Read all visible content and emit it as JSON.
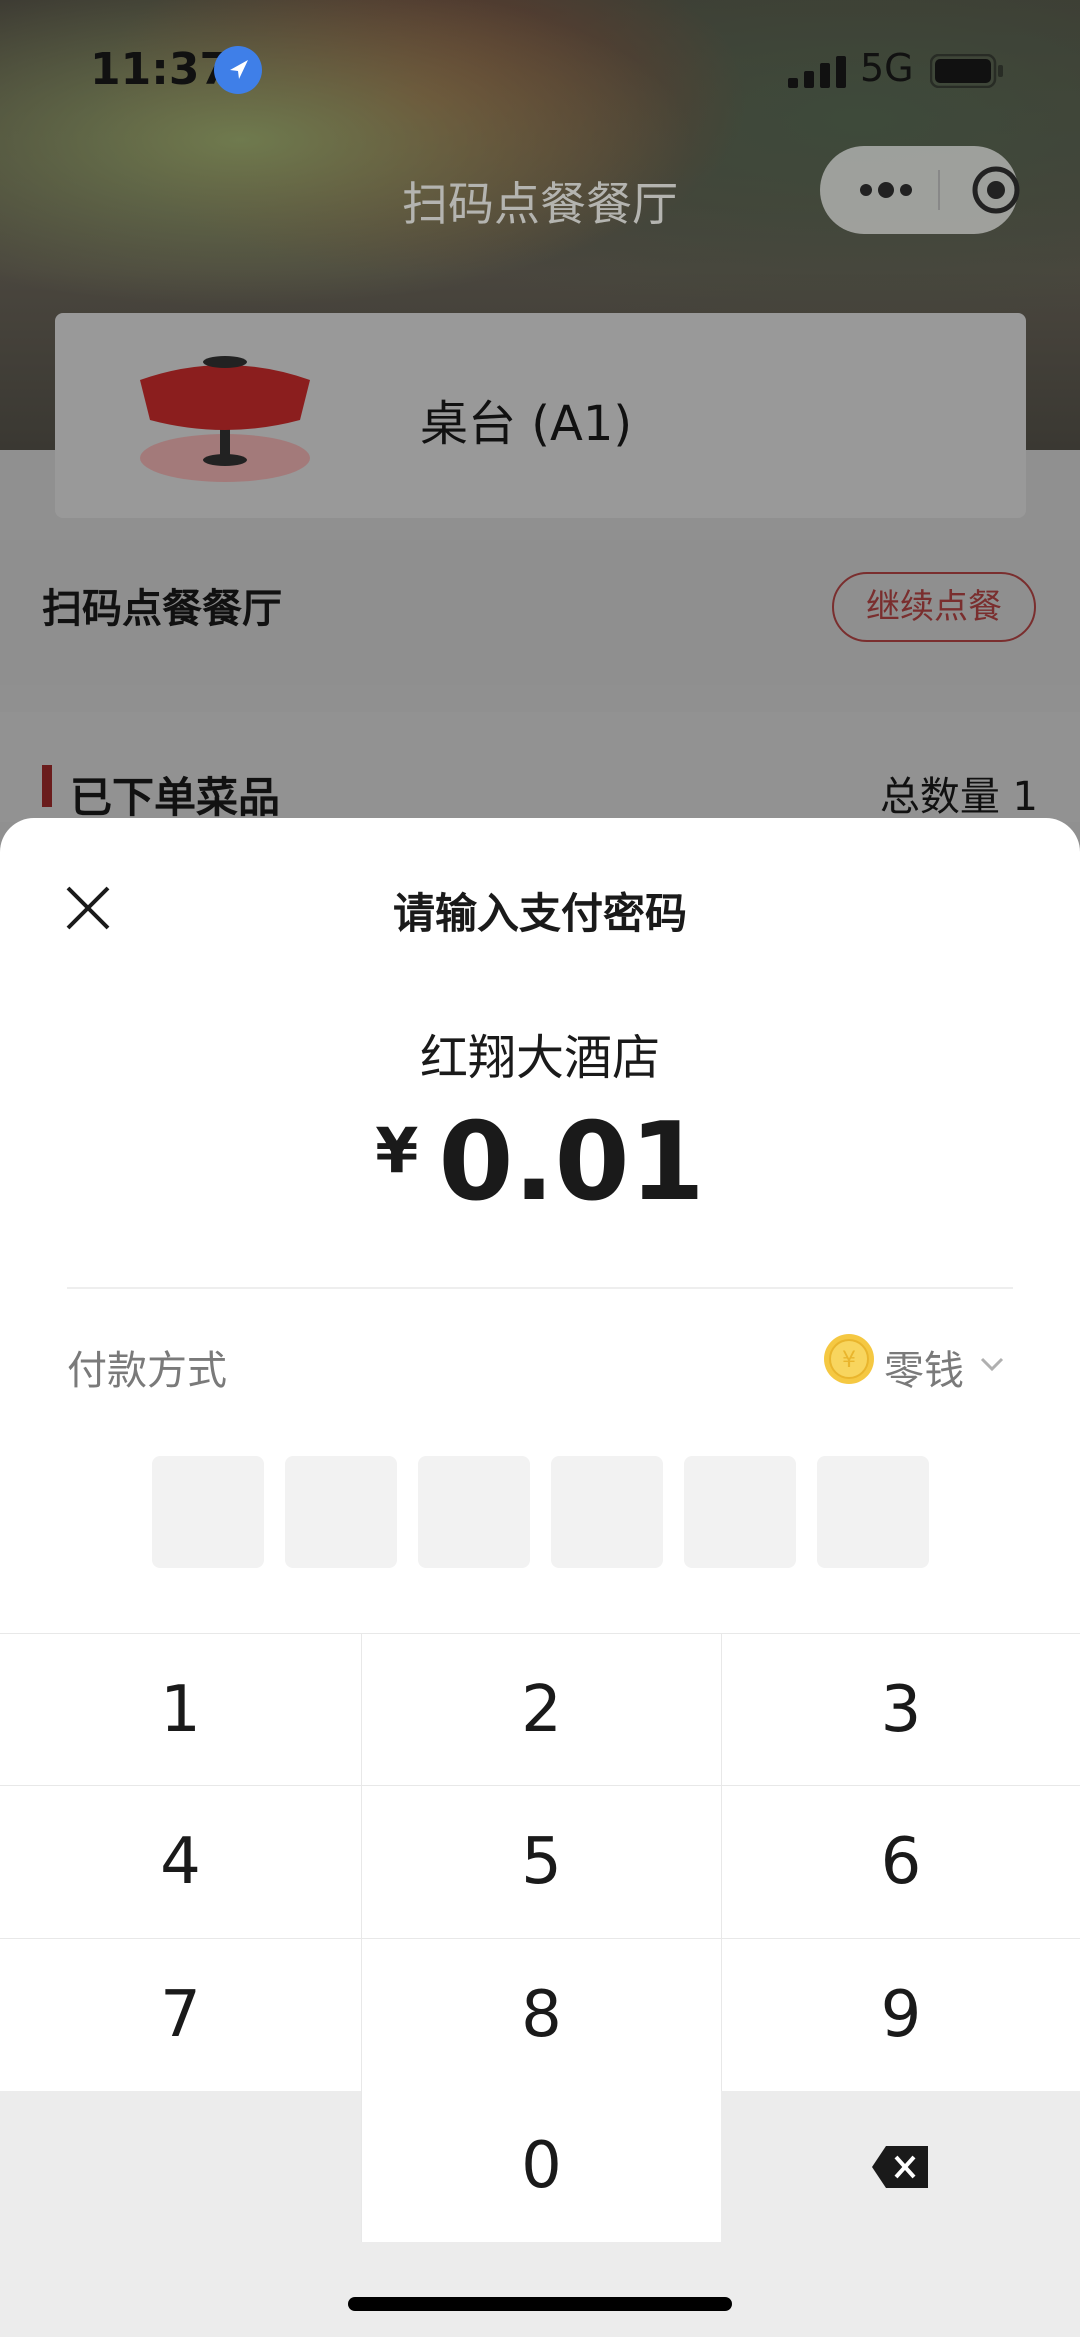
{
  "status_bar": {
    "time": "11:37",
    "network": "5G",
    "location_icon": "location-arrow-icon",
    "signal_icon": "cellular-signal-icon",
    "battery_icon": "battery-icon"
  },
  "header": {
    "title": "扫码点餐餐厅",
    "more_icon": "more-dots-icon",
    "target_icon": "close-miniprogram-icon"
  },
  "table_card": {
    "label": "桌台 (A1)",
    "icon": "dining-table-icon"
  },
  "restaurant": {
    "name": "扫码点餐餐厅",
    "continue_label": "继续点餐"
  },
  "section": {
    "title": "已下单菜品",
    "total": "总数量 1"
  },
  "modal": {
    "title": "请输入支付密码",
    "merchant": "红翔大酒店",
    "currency": "¥",
    "amount": "0.01",
    "payment_label": "付款方式",
    "payment_method": "零钱",
    "coin_icon": "coin-icon",
    "pin_length": 6
  },
  "keypad": {
    "keys": [
      "1",
      "2",
      "3",
      "4",
      "5",
      "6",
      "7",
      "8",
      "9",
      "",
      "0",
      ""
    ],
    "backspace_icon": "backspace-icon"
  },
  "colors": {
    "accent_red": "#c0392b",
    "coin": "#f5c842",
    "pin_box": "#f2f2f2",
    "keypad_bg": "#ececec"
  }
}
